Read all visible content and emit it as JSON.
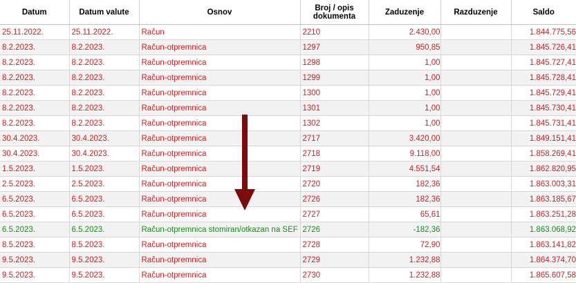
{
  "columns": [
    "Datum",
    "Datum valute",
    "Osnov",
    "Broj / opis dokumenta",
    "Zaduzenje",
    "Razduzenje",
    "Saldo"
  ],
  "rows": [
    {
      "datum": "25.11.2022.",
      "valuta": "25.11.2022.",
      "osnov": "Račun",
      "broj": "2210",
      "zaduzenje": "2.430,00",
      "razduzenje": "",
      "saldo": "1.844.775,56",
      "status": "red"
    },
    {
      "datum": "8.2.2023.",
      "valuta": "8.2.2023.",
      "osnov": "Račun-otpremnica",
      "broj": "1297",
      "zaduzenje": "950,85",
      "razduzenje": "",
      "saldo": "1.845.726,41",
      "status": "red"
    },
    {
      "datum": "8.2.2023.",
      "valuta": "8.2.2023.",
      "osnov": "Račun-otpremnica",
      "broj": "1298",
      "zaduzenje": "1,00",
      "razduzenje": "",
      "saldo": "1.845.727,41",
      "status": "red"
    },
    {
      "datum": "8.2.2023.",
      "valuta": "8.2.2023.",
      "osnov": "Račun-otpremnica",
      "broj": "1299",
      "zaduzenje": "1,00",
      "razduzenje": "",
      "saldo": "1.845.728,41",
      "status": "red"
    },
    {
      "datum": "8.2.2023.",
      "valuta": "8.2.2023.",
      "osnov": "Račun-otpremnica",
      "broj": "1300",
      "zaduzenje": "1,00",
      "razduzenje": "",
      "saldo": "1.845.729,41",
      "status": "red"
    },
    {
      "datum": "8.2.2023.",
      "valuta": "8.2.2023.",
      "osnov": "Račun-otpremnica",
      "broj": "1301",
      "zaduzenje": "1,00",
      "razduzenje": "",
      "saldo": "1.845.730,41",
      "status": "red"
    },
    {
      "datum": "8.2.2023.",
      "valuta": "8.2.2023.",
      "osnov": "Račun-otpremnica",
      "broj": "1302",
      "zaduzenje": "1,00",
      "razduzenje": "",
      "saldo": "1.845.731,41",
      "status": "red"
    },
    {
      "datum": "30.4.2023.",
      "valuta": "30.4.2023.",
      "osnov": "Račun-otpremnica",
      "broj": "2717",
      "zaduzenje": "3.420,00",
      "razduzenje": "",
      "saldo": "1.849.151,41",
      "status": "red"
    },
    {
      "datum": "30.4.2023.",
      "valuta": "30.4.2023.",
      "osnov": "Račun-otpremnica",
      "broj": "2718",
      "zaduzenje": "9.118,00",
      "razduzenje": "",
      "saldo": "1.858.269,41",
      "status": "red"
    },
    {
      "datum": "1.5.2023.",
      "valuta": "1.5.2023.",
      "osnov": "Račun-otpremnica",
      "broj": "2719",
      "zaduzenje": "4.551,54",
      "razduzenje": "",
      "saldo": "1.862.820,95",
      "status": "red"
    },
    {
      "datum": "2.5.2023.",
      "valuta": "2.5.2023.",
      "osnov": "Račun-otpremnica",
      "broj": "2720",
      "zaduzenje": "182,36",
      "razduzenje": "",
      "saldo": "1.863.003,31",
      "status": "red"
    },
    {
      "datum": "6.5.2023.",
      "valuta": "6.5.2023.",
      "osnov": "Račun-otpremnica",
      "broj": "2726",
      "zaduzenje": "182,36",
      "razduzenje": "",
      "saldo": "1.863.185,67",
      "status": "red"
    },
    {
      "datum": "6.5.2023.",
      "valuta": "6.5.2023.",
      "osnov": "Račun-otpremnica",
      "broj": "2727",
      "zaduzenje": "65,61",
      "razduzenje": "",
      "saldo": "1.863.251,28",
      "status": "red"
    },
    {
      "datum": "6.5.2023.",
      "valuta": "6.5.2023.",
      "osnov": "Račun-otpremnica stomiran/otkazan na SEF",
      "broj": "2726",
      "zaduzenje": "-182,36",
      "razduzenje": "",
      "saldo": "1.863.068,92",
      "status": "green"
    },
    {
      "datum": "8.5.2023.",
      "valuta": "8.5.2023.",
      "osnov": "Račun-otpremnica",
      "broj": "2728",
      "zaduzenje": "72,90",
      "razduzenje": "",
      "saldo": "1.863.141,82",
      "status": "red"
    },
    {
      "datum": "9.5.2023.",
      "valuta": "9.5.2023.",
      "osnov": "Račun-otpremnica",
      "broj": "2729",
      "zaduzenje": "1.232,88",
      "razduzenje": "",
      "saldo": "1.864.374,70",
      "status": "red"
    },
    {
      "datum": "9.5.2023.",
      "valuta": "9.5.2023.",
      "osnov": "Račun-otpremnica",
      "broj": "2730",
      "zaduzenje": "1.232,88",
      "razduzenje": "",
      "saldo": "1.865.607,58",
      "status": "red"
    }
  ],
  "colors": {
    "debit_row": "#d11a1a",
    "cancelled_row": "#139113",
    "arrow": "#7a0c0c"
  },
  "annotation": {
    "icon": "down-arrow-icon"
  }
}
